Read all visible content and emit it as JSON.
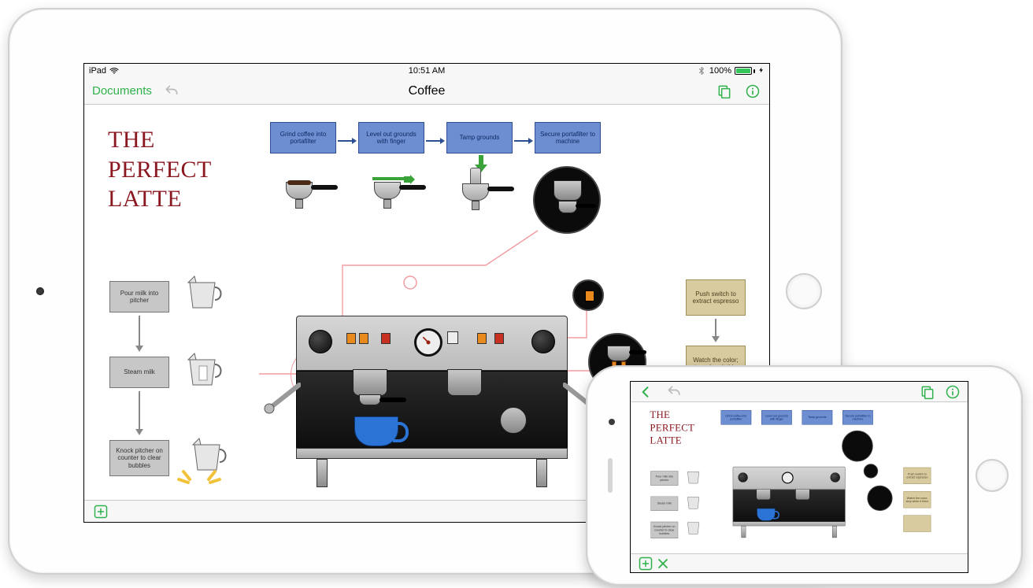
{
  "status": {
    "carrier": "iPad",
    "time": "10:51 AM",
    "battery_percent": "100%"
  },
  "nav": {
    "back_label": "Documents",
    "title": "Coffee"
  },
  "diagram": {
    "title_line1": "THE",
    "title_line2": "PERFECT",
    "title_line3": "LATTE",
    "flow": [
      "Grind coffee into portafilter",
      "Level out grounds with finger",
      "Tamp grounds",
      "Secure portafilter to machine"
    ],
    "left_steps": [
      "Pour milk into pitcher",
      "Steam milk",
      "Knock pitcher on counter to clear bubbles"
    ],
    "right_steps": [
      "Push switch to extract espresso",
      "Watch the color; stop when it thins"
    ]
  },
  "colors": {
    "accent": "#2fb24c",
    "title": "#8a1820",
    "flow_box": "#6d8fd1",
    "tan_box": "#d9cba0",
    "cup": "#2b74d6"
  }
}
